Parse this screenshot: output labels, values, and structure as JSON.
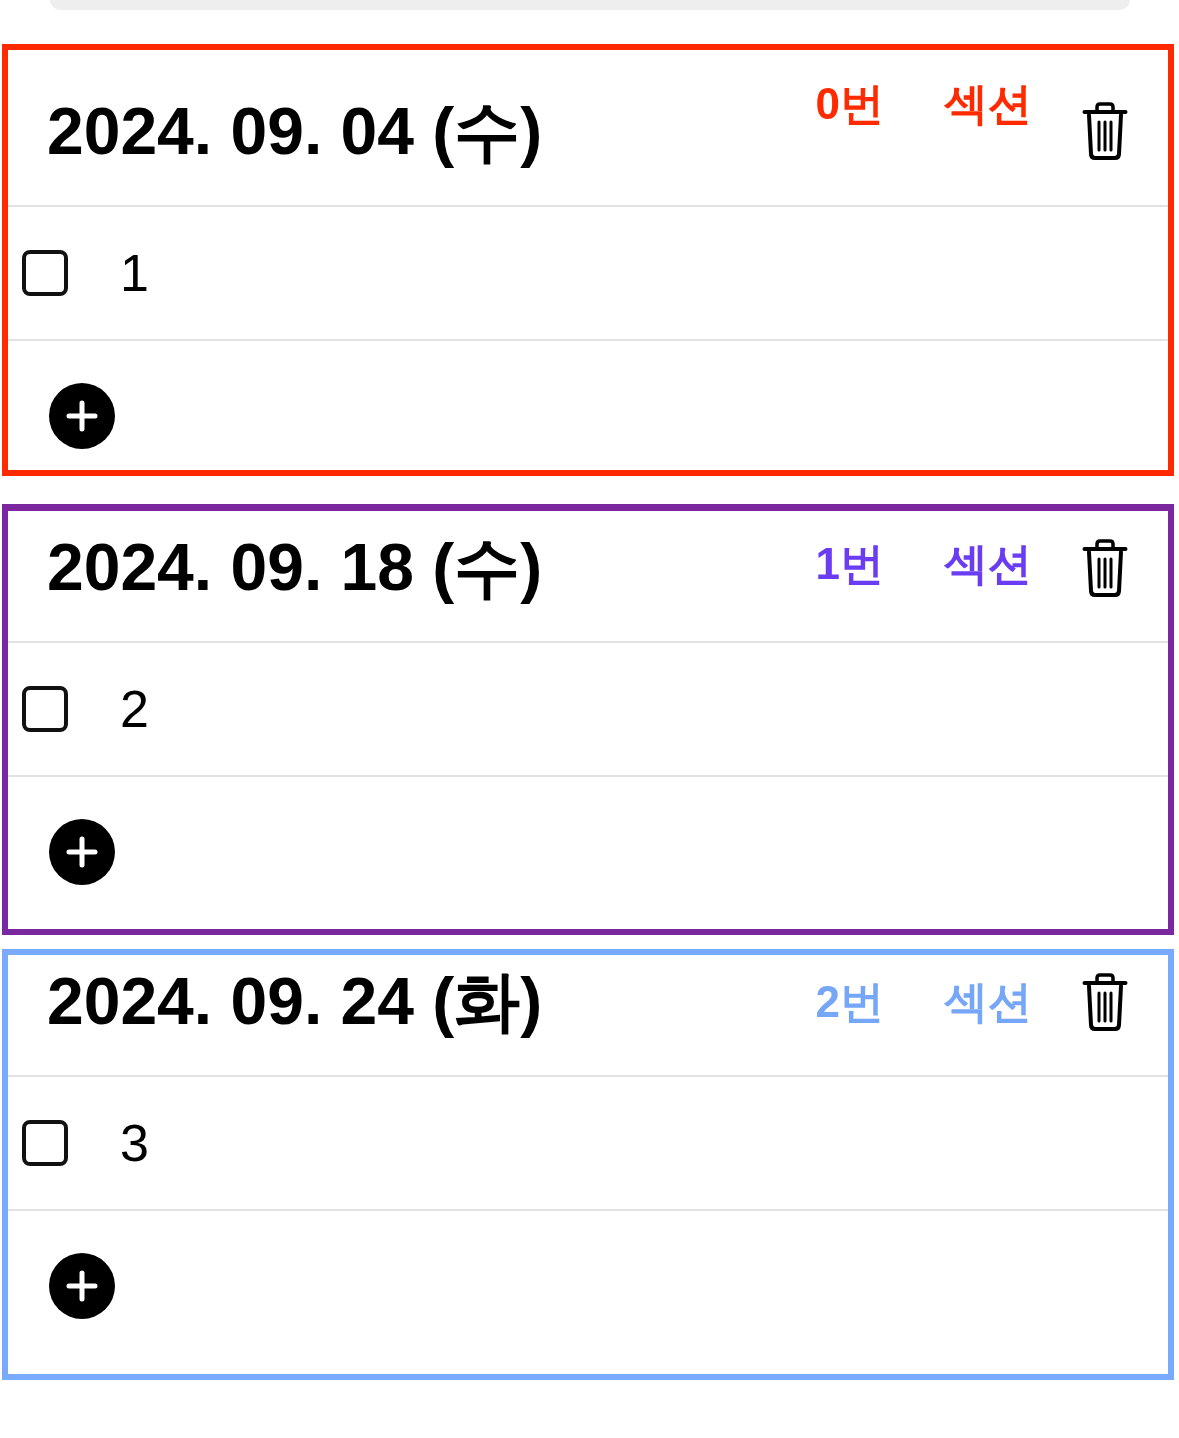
{
  "sections": [
    {
      "date": "2024. 09. 04 (수)",
      "color": "#ff2a00",
      "labels": [
        {
          "text": "0번",
          "color": "#ff2a00"
        },
        {
          "text": "섹션",
          "color": "#ff2a00"
        }
      ],
      "tasks": [
        {
          "text": "1",
          "checked": false
        }
      ]
    },
    {
      "date": "2024. 09. 18 (수)",
      "color": "#7b27a0",
      "labels": [
        {
          "text": "1번",
          "color": "#6a3cf2"
        },
        {
          "text": "섹션",
          "color": "#6a3cf2"
        }
      ],
      "tasks": [
        {
          "text": "2",
          "checked": false
        }
      ]
    },
    {
      "date": "2024. 09. 24 (화)",
      "color": "#79aafd",
      "labels": [
        {
          "text": "2번",
          "color": "#76a6f8"
        },
        {
          "text": "섹션",
          "color": "#76a6f8"
        }
      ],
      "tasks": [
        {
          "text": "3",
          "checked": false
        }
      ]
    }
  ]
}
